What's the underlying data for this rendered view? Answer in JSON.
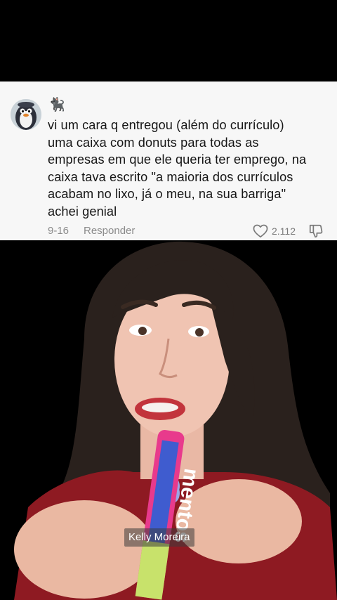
{
  "comment": {
    "emoji": "🐈‍⬛",
    "text": "vi um cara q entregou (além do currículo)\numa caixa com donuts para todas as\nempresas em que ele queria ter emprego, na\ncaixa tava escrito \"a maioria dos currículos\nacabam no lixo, já o meu, na sua barriga\"\nachei genial",
    "date": "9-16",
    "reply_label": "Responder",
    "like_count": "2.112",
    "icons": {
      "avatar": "penguin-avatar",
      "like": "heart-icon",
      "dislike": "dislike-icon"
    }
  },
  "video": {
    "caption": "Kelly Moreira",
    "candy_label": "mentos"
  }
}
